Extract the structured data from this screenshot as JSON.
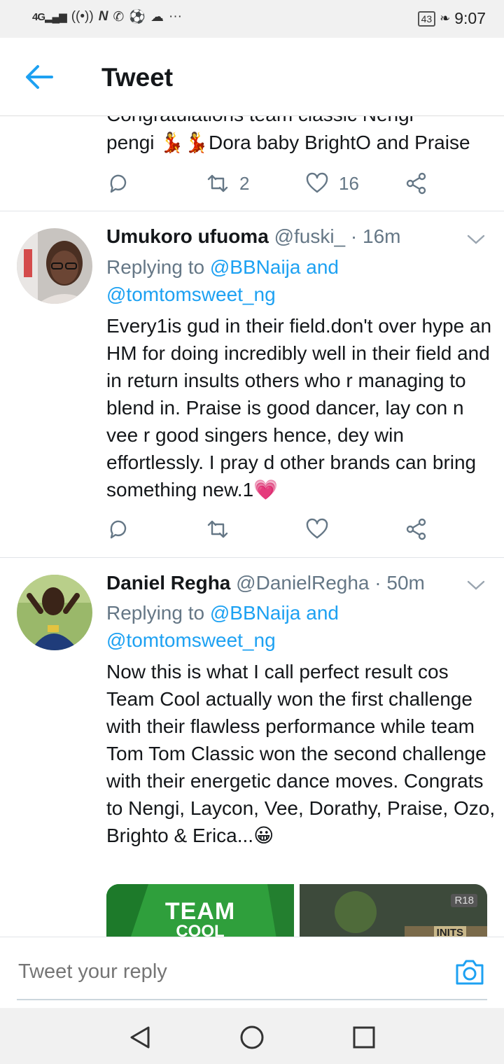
{
  "status_bar": {
    "network": "4G",
    "battery": "43",
    "time": "9:07",
    "more": "···"
  },
  "header": {
    "title": "Tweet"
  },
  "partial_tweet": {
    "text_top": "Congratulations team classic Nengi",
    "text_line2": "pengi 💃💃Dora baby BrightO and Praise",
    "retweets": "2",
    "likes": "16"
  },
  "tweets": [
    {
      "name": "Umukoro ufuoma",
      "handle": "@fuski_",
      "time": "· 16m",
      "replying_prefix": "Replying to",
      "replying_to_1": "@BBNaija",
      "replying_and": "and",
      "replying_to_2": "@tomtomsweet_ng",
      "text": "Every1is gud in their field.don't over hype an HM for doing incredibly well in their field and in return insults others who r managing to blend in. Praise is good dancer, lay con n vee r good singers hence, dey win effortlessly. I pray d other brands can bring something new.1💗"
    },
    {
      "name": "Daniel Regha",
      "handle": "@DanielRegha",
      "time": "· 50m",
      "replying_prefix": "Replying to",
      "replying_to_1": "@BBNaija",
      "replying_and": "and",
      "replying_to_2": "@tomtomsweet_ng",
      "text": "Now this is what I call perfect result cos Team Cool actually won the first challenge with their flawless performance while team Tom Tom Classic won the second challenge with their  energetic dance moves. Congrats to Nengi, Laycon, Vee, Dorathy, Praise, Ozo, Brighto & Erica...😀",
      "media_text_1": "TEAM",
      "media_text_2": "COOL",
      "media_badge": "R18",
      "media_caption": "INITS"
    }
  ],
  "reply": {
    "placeholder": "Tweet your reply"
  },
  "colors": {
    "accent": "#1da1f2",
    "secondary_text": "#657786",
    "primary_text": "#14171a"
  }
}
